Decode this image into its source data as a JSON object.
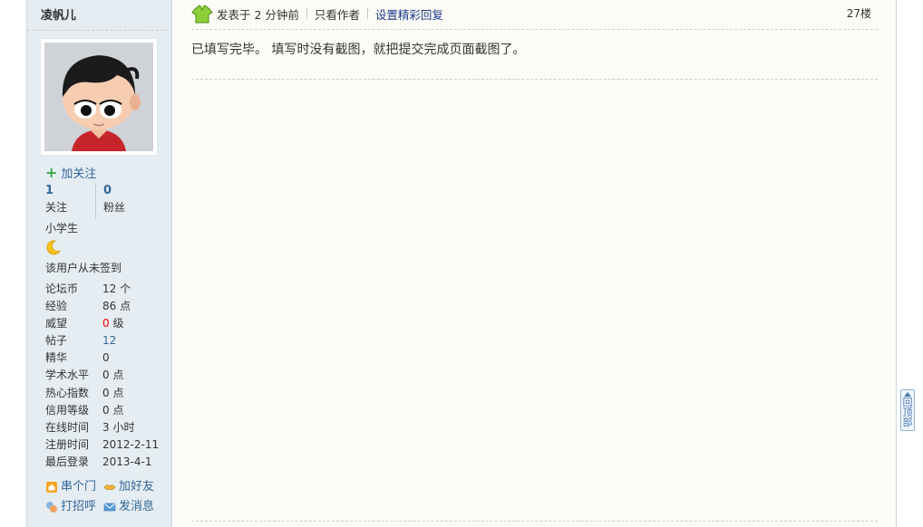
{
  "author": {
    "username": "凌帆儿",
    "follow_label": "加关注",
    "following_count": "1",
    "following_label": "关注",
    "followers_count": "0",
    "followers_label": "粉丝",
    "grade": "小学生",
    "signin_status": "该用户从未签到"
  },
  "profile": [
    {
      "key": "论坛币",
      "value": "12 个"
    },
    {
      "key": "经验",
      "value": "86 点"
    },
    {
      "key": "威望",
      "value_red": "0",
      "value_suffix": " 级"
    },
    {
      "key": "帖子",
      "value": "12"
    },
    {
      "key": "精华",
      "value": "0"
    },
    {
      "key": "学术水平",
      "value": "0 点"
    },
    {
      "key": "热心指数",
      "value": "0 点"
    },
    {
      "key": "信用等级",
      "value": "0 点"
    },
    {
      "key": "在线时间",
      "value": "3 小时"
    },
    {
      "key": "注册时间",
      "value": "2012-2-11"
    },
    {
      "key": "最后登录",
      "value": "2013-4-1"
    }
  ],
  "actions": {
    "visit": "串个门",
    "add_friend": "加好友",
    "greet": "打招呼",
    "message": "发消息"
  },
  "post": {
    "posted_time": "发表于 2 分钟前",
    "only_author": "只看作者",
    "set_highlight": "设置精彩回复",
    "floor": "27楼",
    "content": "已填写完毕。  填写时没有截图，就把提交完成页面截图了。"
  },
  "back_to_top": {
    "label": "回顶部"
  },
  "colors": {
    "sidebar_bg": "#e5edf2",
    "content_bg": "#fdfbf6",
    "link_blue": "#336699",
    "highlight_link": "#1a3b8a",
    "warning_red": "#ff0000"
  }
}
